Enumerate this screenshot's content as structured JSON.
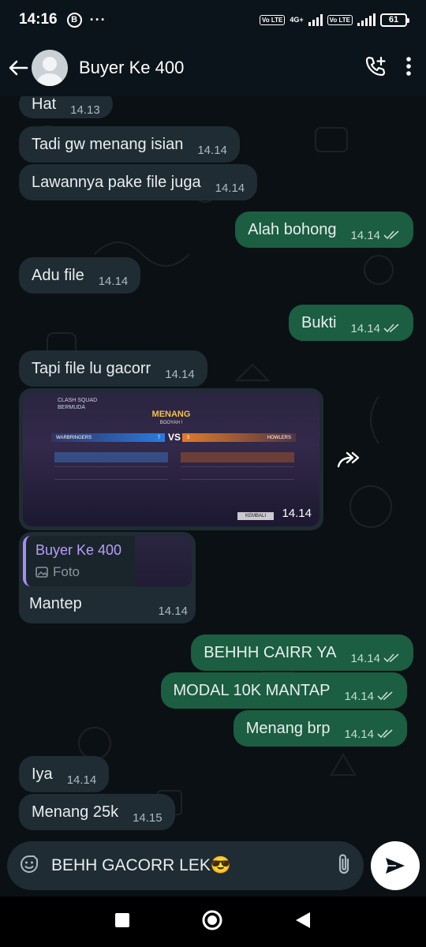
{
  "status_bar": {
    "time": "14:16",
    "b_icon": "B",
    "more": "···",
    "volte1": "Vo LTE",
    "net1": "4G+",
    "volte2": "Vo LTE",
    "battery": "61"
  },
  "header": {
    "contact_name": "Buyer Ke 400"
  },
  "messages": [
    {
      "dir": "in",
      "text": "Hat",
      "time": "14.13"
    },
    {
      "dir": "in",
      "text": "Tadi gw menang isian",
      "time": "14.14"
    },
    {
      "dir": "in",
      "text": "Lawannya pake file juga",
      "time": "14.14"
    },
    {
      "dir": "out",
      "text": "Alah bohong",
      "time": "14.14"
    },
    {
      "dir": "in",
      "text": "Adu file",
      "time": "14.14"
    },
    {
      "dir": "out",
      "text": "Bukti",
      "time": "14.14"
    },
    {
      "dir": "in",
      "text": "Tapi file lu gacorr",
      "time": "14.14"
    },
    {
      "dir": "out",
      "text": "BEHHH CAIRR YA",
      "time": "14.14"
    },
    {
      "dir": "out",
      "text": "MODAL 10K MANTAP",
      "time": "14.14"
    },
    {
      "dir": "out",
      "text": "Menang brp",
      "time": "14.14"
    },
    {
      "dir": "in",
      "text": "Iya",
      "time": "14.14"
    },
    {
      "dir": "in",
      "text": "Menang 25k",
      "time": "14.15"
    }
  ],
  "photo_message": {
    "time": "14.14",
    "game": {
      "mode": "CLASH SQUAD",
      "map": "BERMUDA",
      "result": "MENANG",
      "subtitle": "BOOYAH !",
      "team1": "WARBRINGERS",
      "team1_score": "7",
      "team2": "HOWLERS",
      "team2_score": "5",
      "vs": "VS",
      "back_button": "KEMBALI"
    }
  },
  "reply_message": {
    "quoted_name": "Buyer Ke 400",
    "quoted_type": "Foto",
    "text": "Mantep",
    "time": "14.14"
  },
  "composer": {
    "text": "BEHH GACORR LEK😎"
  },
  "colors": {
    "incoming_bubble": "#1f2c33",
    "outgoing_bubble": "#1b5e41",
    "header_bg": "#0b141a",
    "quote_accent": "#a78bfa"
  }
}
